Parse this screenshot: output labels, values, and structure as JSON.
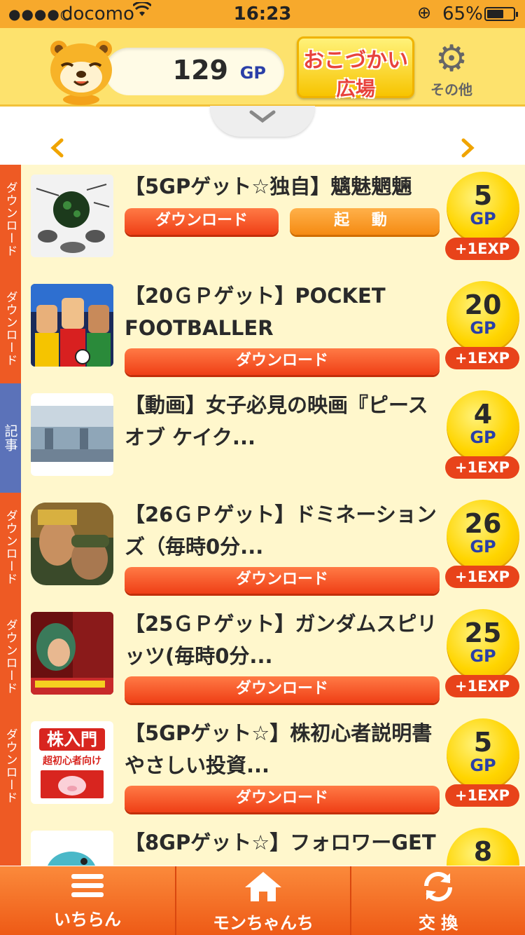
{
  "status_bar": {
    "signal_dots": "●●●●○",
    "carrier": "docomo",
    "time": "16:23",
    "battery_percent": "65%",
    "battery_level": 0.65
  },
  "header": {
    "points_value": "129",
    "points_unit": "GP",
    "plaza_label_1": "おこづかい",
    "plaza_label_2": "広場",
    "settings_label": "その他"
  },
  "offers": [
    {
      "category": "ダウンロード",
      "title": "【5GPゲット☆独自】魑魅魍魎",
      "buttons": [
        "ダウンロード",
        "起 動"
      ],
      "reward": "5",
      "unit": "GP",
      "exp": "+1EXP"
    },
    {
      "category": "ダウンロード",
      "title": "【20ＧＰゲット】POCKET FOOTBALLER",
      "buttons": [
        "ダウンロード"
      ],
      "reward": "20",
      "unit": "GP",
      "exp": "+1EXP"
    },
    {
      "category": "記事",
      "title": "【動画】女子必見の映画『ピースオブ ケイク...",
      "buttons": [],
      "reward": "4",
      "unit": "GP",
      "exp": "+1EXP"
    },
    {
      "category": "ダウンロード",
      "title": "【26ＧＰゲット】ドミネーションズ（毎時0分...",
      "buttons": [
        "ダウンロード"
      ],
      "reward": "26",
      "unit": "GP",
      "exp": "+1EXP"
    },
    {
      "category": "ダウンロード",
      "title": "【25ＧＰゲット】ガンダムスピリッツ(毎時0分...",
      "buttons": [
        "ダウンロード"
      ],
      "reward": "25",
      "unit": "GP",
      "exp": "+1EXP"
    },
    {
      "category": "ダウンロード",
      "title": "【5GPゲット☆】株初心者説明書やさしい投資...",
      "thumb_text_1": "株入門",
      "thumb_text_2": "超初心者向け",
      "buttons": [
        "ダウンロード"
      ],
      "reward": "5",
      "unit": "GP",
      "exp": "+1EXP"
    },
    {
      "category": "ダウ",
      "title": "【8GPゲット☆】フォロワーGET",
      "buttons": [],
      "reward": "8",
      "unit": "",
      "exp": ""
    }
  ],
  "tabbar": {
    "list_label": "いちらん",
    "home_label": "モンちゃんち",
    "exchange_label": "交 換"
  }
}
